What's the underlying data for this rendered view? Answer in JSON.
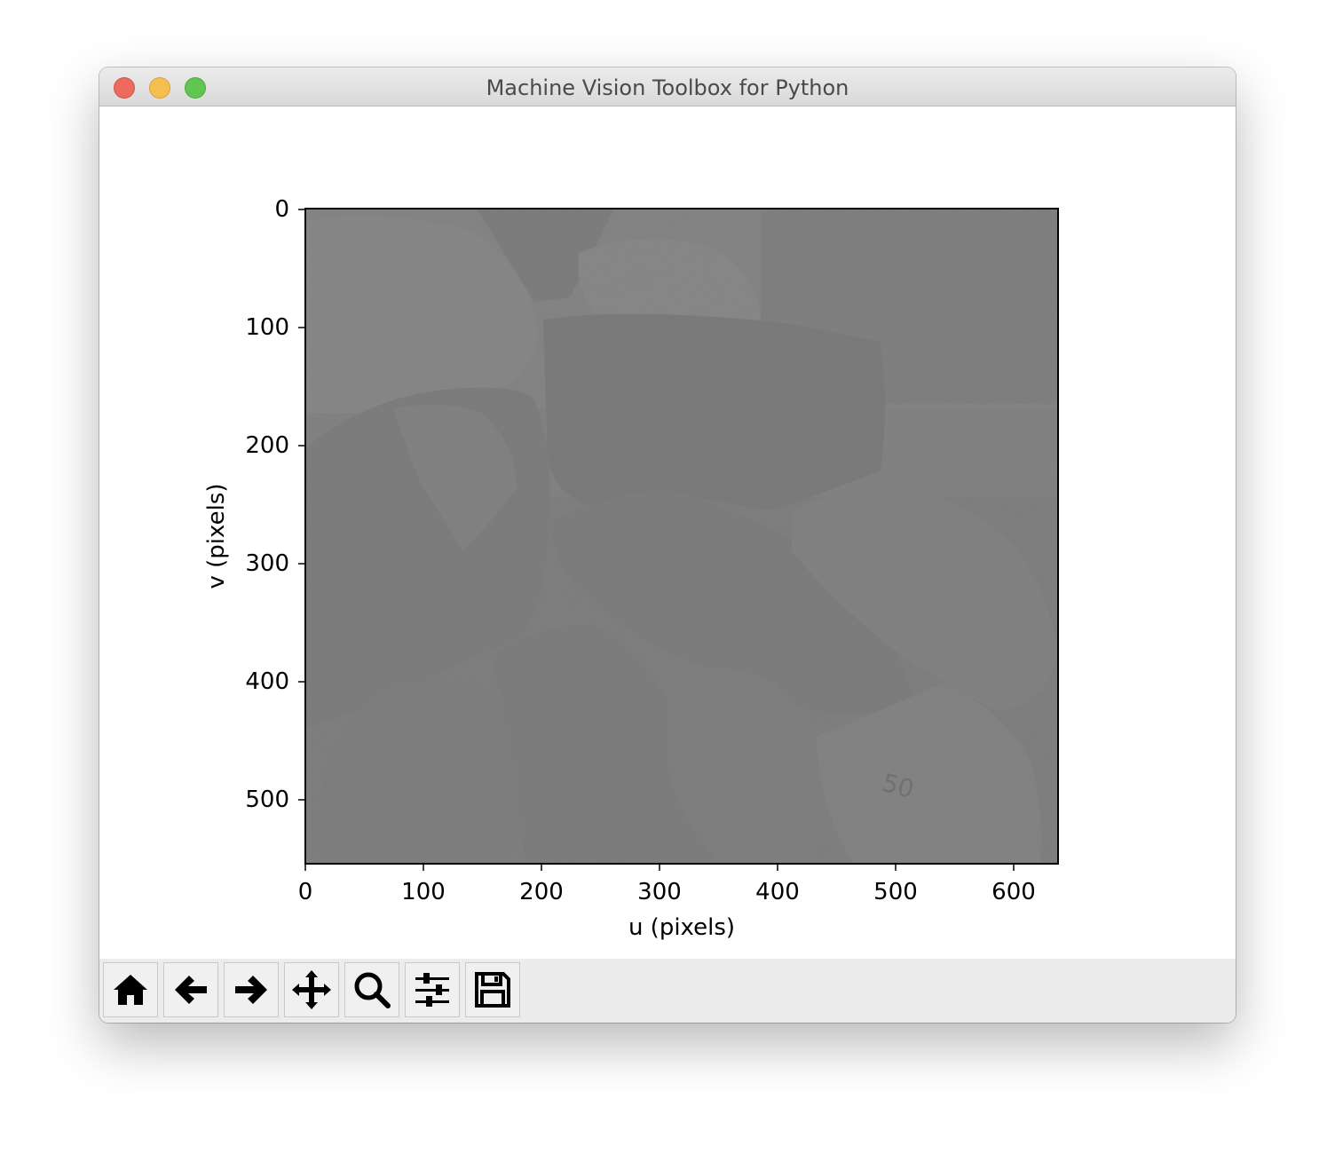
{
  "window": {
    "title": "Machine Vision Toolbox for Python"
  },
  "plot": {
    "xlabel": "u (pixels)",
    "ylabel": "v (pixels)",
    "xticks": [
      "0",
      "100",
      "200",
      "300",
      "400",
      "500",
      "600"
    ],
    "yticks": [
      "0",
      "100",
      "200",
      "300",
      "400",
      "500"
    ],
    "image_content": "grayscale photo of a pile of rocks"
  },
  "toolbar": {
    "buttons": [
      "home-icon",
      "back-arrow-icon",
      "forward-arrow-icon",
      "pan-icon",
      "zoom-icon",
      "configure-subplots-icon",
      "save-icon"
    ]
  },
  "colors": {
    "close": "#ed6a5e",
    "minimize": "#f5bf4f",
    "zoom": "#61c554",
    "toolbar_bg": "#ececec"
  }
}
